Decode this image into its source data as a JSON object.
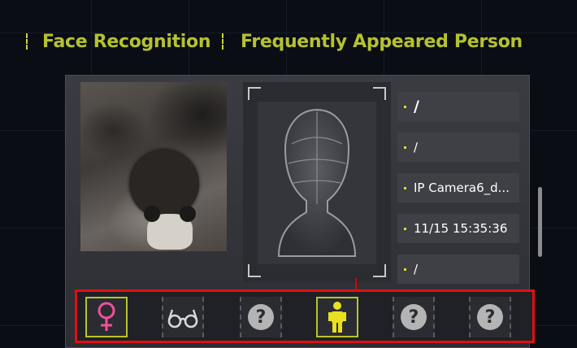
{
  "tabs": [
    {
      "label": "Face Recognition"
    },
    {
      "label": "Frequently Appeared Person"
    }
  ],
  "info": [
    {
      "value": "/"
    },
    {
      "value": "/"
    },
    {
      "value": "IP Camera6_d..."
    },
    {
      "value": "11/15 15:35:36"
    },
    {
      "value": "/"
    }
  ],
  "attributes": [
    {
      "icon": "female-gender-icon",
      "state": "active",
      "color": "#f0509a"
    },
    {
      "icon": "glasses-icon",
      "state": "inactive",
      "color": "#d8d8d8"
    },
    {
      "icon": "unknown-icon",
      "state": "inactive",
      "glyph": "?"
    },
    {
      "icon": "person-uniform-icon",
      "state": "active",
      "color": "#e8e020"
    },
    {
      "icon": "unknown-icon",
      "state": "inactive",
      "glyph": "?"
    },
    {
      "icon": "unknown-icon",
      "state": "inactive",
      "glyph": "?"
    }
  ],
  "colors": {
    "accent": "#b5c230",
    "highlight_border": "#e01010",
    "info_dot": "#e6d82a"
  }
}
